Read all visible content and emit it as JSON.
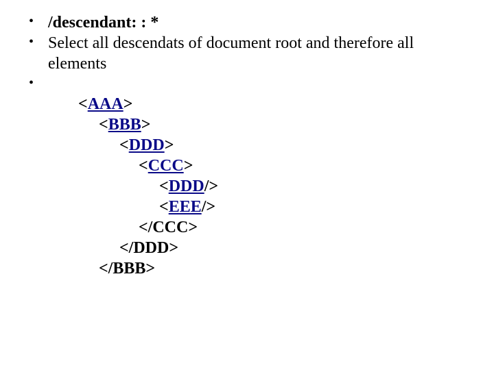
{
  "bullets": {
    "b1": "/descendant: : *",
    "b2": "Select all descendats of document root and therefore all elements",
    "b3": ""
  },
  "code": {
    "l0_open": "<AAA>",
    "l1_open": "<BBB>",
    "l2_open": "<DDD>",
    "l3_open": "<CCC>",
    "l4_ddd": "<DDD/>",
    "l4_eee": "<EEE/>",
    "l3_close": "</CCC>",
    "l2_close": "</DDD>",
    "l1_close": "</BBB>"
  },
  "link_texts": {
    "aaa": "AAA",
    "bbb": "BBB",
    "ddd": "DDD",
    "ccc": "CCC",
    "ddd2": "DDD",
    "eee": "EEE"
  }
}
